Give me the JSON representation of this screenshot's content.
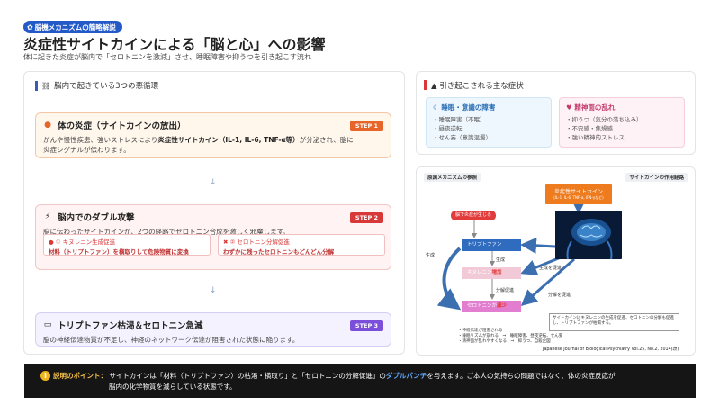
{
  "header": {
    "badge": "脳機メカニズムの簡略解説",
    "title": "炎症性サイトカインによる「脳と心」への影響",
    "subtitle": "体に起きた炎症が脳内で「セロトニンを激減」させ、睡眠障害や抑うつを引き起こす流れ"
  },
  "left_panel": {
    "title": "脳内で起きている3つの悪循環",
    "step1": {
      "title": "体の炎症（サイトカインの放出）",
      "badge": "STEP 1",
      "body_pre": "がんや慢性疾患、強いストレスにより",
      "body_bold": "炎症性サイトカイン（IL-1, IL-6, TNF-α等）",
      "body_post": "が分泌され、脳に",
      "body_line2": "炎症シグナルが伝わります。"
    },
    "step2": {
      "title": "脳内でのダブル攻撃",
      "badge": "STEP 2",
      "body": "脳に伝わったサイトカインが、2つの経路でセロトニン合成を激しく邪魔します。",
      "sub1_label": "① キヌレニン生成促進",
      "sub1_detail": "材料（トリプトファン）を横取りして危険物質に変換",
      "sub2_label": "② セロトニン分解促進",
      "sub2_detail": "わずかに残ったセロトニンもどんどん分解"
    },
    "step3": {
      "title": "トリプトファン枯渇＆セロトニン急減",
      "badge": "STEP 3",
      "body": "脳の神経伝達物質が不足し、神経のネットワーク伝達が阻害された状態に陥ります。"
    }
  },
  "symptoms": {
    "title": "引き起こされる主な症状",
    "sleep_title": "睡眠・意識の障害",
    "sleep_items": [
      "睡眠障害（不眠）",
      "昼夜逆転",
      "せん妄（意識混濁）"
    ],
    "mental_title": "精神面の乱れ",
    "mental_items": [
      "抑うつ（気分の落ち込み）",
      "不安感・焦燥感",
      "強い精神的ストレス"
    ]
  },
  "diagram": {
    "header_left": "原図メカニズムの参照",
    "header_right": "サイトカインの作用経路",
    "cytokine": "炎症性サイトカイン",
    "cytokine_sub": "(IL-1, IL-6, TNF-α, IFN-γなど)",
    "inflammation": "脳で炎症が生じる",
    "tryptophan": "トリプトファン",
    "kynurenine": "キヌレニン",
    "kynurenine_suffix": "増加",
    "serotonin": "セロトニンが",
    "serotonin_suffix": "減少",
    "label_produce1": "生成",
    "label_produce2": "生成",
    "label_promote1": "生成を促進",
    "label_promote2": "分解を促進",
    "label_decomp": "分解促進",
    "note": "サイトカインはキヌレニンの生成を促進、セロトニンの分解も促進し、トリプトファンが枯渇する。",
    "effects": [
      "・神経伝達が阻害される",
      "・睡眠リズムが崩れる　⇒　睡眠障害、昼夜逆転、せん妄",
      "・精神面が乱れやすくなる　⇒　抑うつ、自殺企図"
    ],
    "citation": "Japanese Journal of Biological Psychiatry Vol.25, No.2, 2014(改)"
  },
  "footer": {
    "label": "説明のポイント：",
    "text1": "サイトカインは「材料（トリプトファン）の枯渇・横取り」と「セロトニンの分解促進」の",
    "highlight": "ダブルパンチ",
    "text2": "を与えます。ご本人の気持ちの問題ではなく、体の炎症反応が",
    "line2": "脳内の化学物質を減らしている状態です。"
  }
}
